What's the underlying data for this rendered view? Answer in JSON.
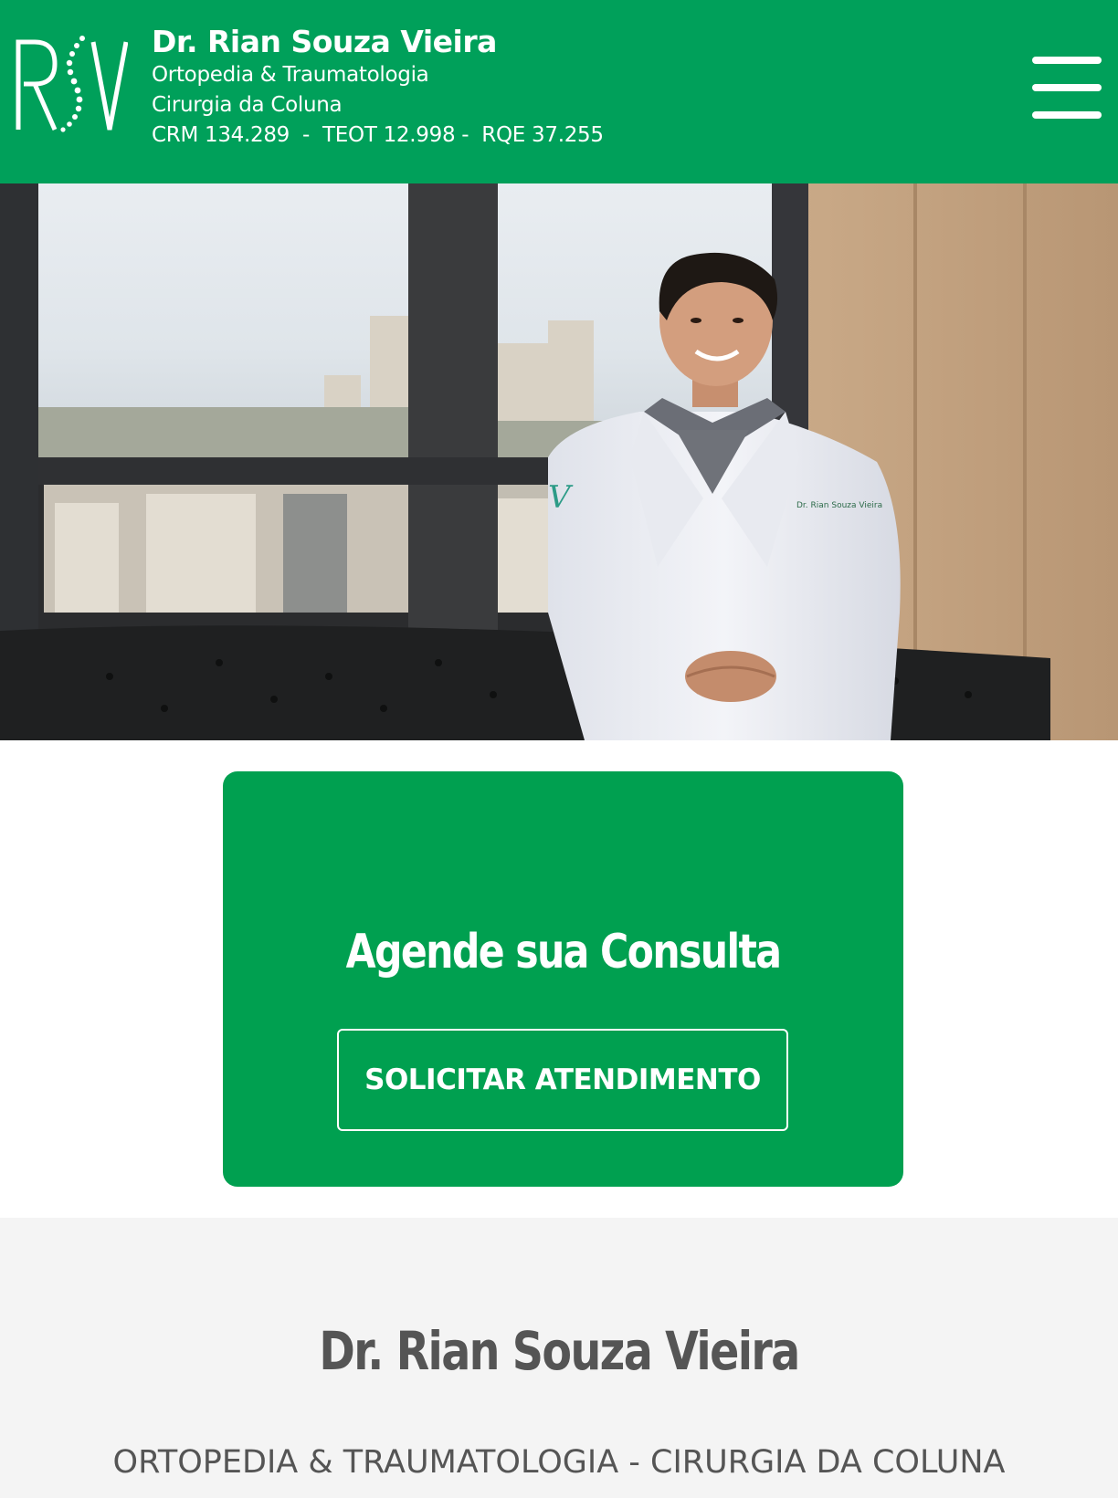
{
  "header": {
    "name": "Dr. Rian Souza Vieira",
    "specialty": "Ortopedia & Traumatologia",
    "subspecialty": "Cirurgia da Coluna",
    "registrations": "CRM 134.289  -  TEOT 12.998 -  RQE 37.255",
    "logo_letters": "RSV",
    "menu_icon": "hamburger-menu-icon"
  },
  "hero": {
    "image": "doctor-portrait-photo"
  },
  "cta": {
    "title": "Agende sua Consulta",
    "button_label": "SOLICITAR ATENDIMENTO"
  },
  "about": {
    "title": "Dr. Rian Souza Vieira",
    "subtitle": "ORTOPEDIA & TRAUMATOLOGIA - CIRURGIA DA COLUNA"
  },
  "colors": {
    "brand_green": "#00a05a",
    "cta_green": "#00a050",
    "about_bg": "#f4f4f4",
    "text_gray": "#555555"
  }
}
